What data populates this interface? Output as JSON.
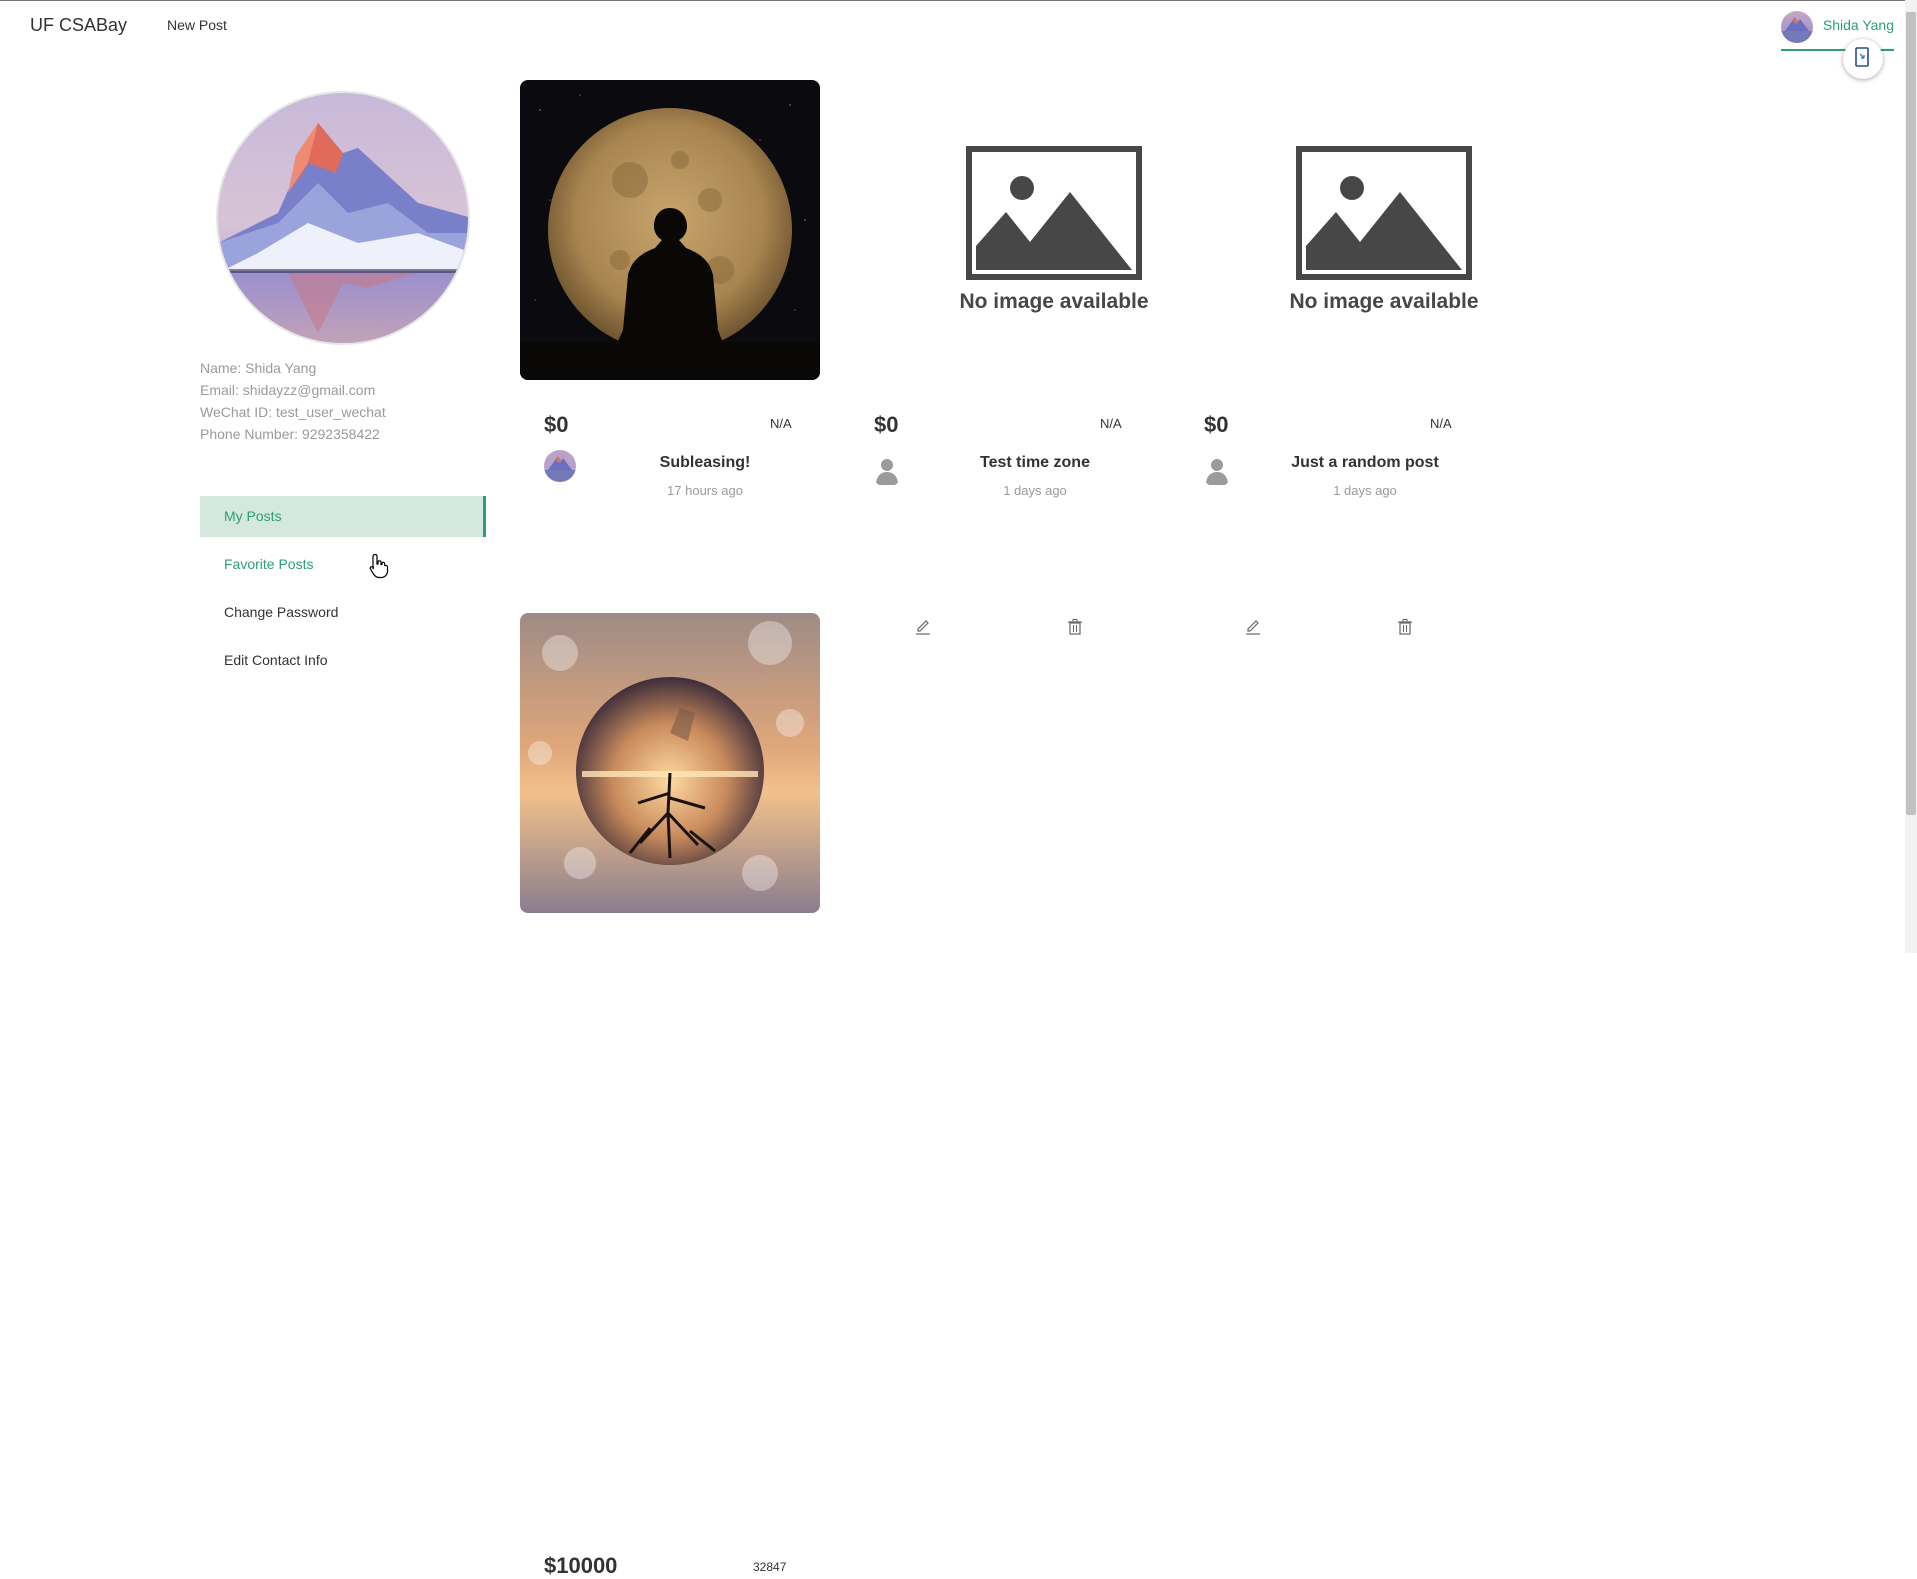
{
  "colors": {
    "accent": "#2e9e74",
    "active_bg": "#d5e8dd",
    "muted_text": "#9a9a9a"
  },
  "navbar": {
    "brand": "UF CSABay",
    "new_post": "New Post",
    "user_name": "Shida Yang",
    "fab_icon": "logout-icon"
  },
  "profile": {
    "name_line": "Name: Shida Yang",
    "email_line": "Email: shidayzz@gmail.com",
    "wechat_line": "WeChat ID: test_user_wechat",
    "phone_line": "Phone Number: 9292358422"
  },
  "sidebar": {
    "items": [
      {
        "label": "My Posts",
        "state": "active"
      },
      {
        "label": "Favorite Posts",
        "state": "hover"
      },
      {
        "label": "Change Password",
        "state": "normal"
      },
      {
        "label": "Edit Contact Info",
        "state": "normal"
      }
    ]
  },
  "posts": [
    {
      "price": "$0",
      "location": "N/A",
      "title": "Subleasing!",
      "time": "17 hours ago",
      "image": "moon-silhouette-photo",
      "author_avatar": "user-avatar-photo"
    },
    {
      "price": "$0",
      "location": "N/A",
      "title": "Test time zone",
      "time": "1 days ago",
      "image_placeholder": "No image available",
      "author_avatar": "default-user-icon"
    },
    {
      "price": "$0",
      "location": "N/A",
      "title": "Just a random post",
      "time": "1 days ago",
      "image_placeholder": "No image available",
      "author_avatar": "default-user-icon"
    },
    {
      "price": "$10000",
      "location": "32847",
      "image": "crystal-ball-tree-photo"
    }
  ]
}
